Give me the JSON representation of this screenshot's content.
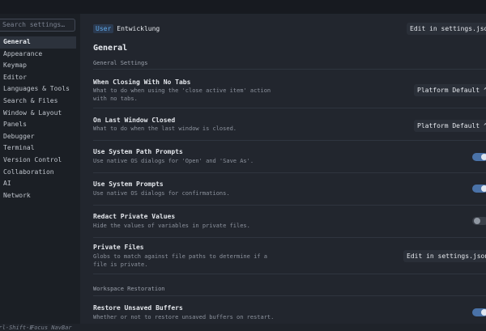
{
  "sidebar": {
    "search_placeholder": "Search settings…",
    "items": [
      "General",
      "Appearance",
      "Keymap",
      "Editor",
      "Languages & Tools",
      "Search & Files",
      "Window & Layout",
      "Panels",
      "Debugger",
      "Terminal",
      "Version Control",
      "Collaboration",
      "AI",
      "Network"
    ],
    "active_index": 0,
    "hint_key": "Ctrl-Shift-E",
    "hint_label": "Focus NavBar"
  },
  "header": {
    "scope_badge": "User",
    "project": "Entwicklung",
    "edit_button": "Edit in settings.json"
  },
  "main": {
    "page_title": "General",
    "section_general": "General Settings",
    "settings": {
      "closing": {
        "title": "When Closing With No Tabs",
        "desc": "What to do when using the 'close active item' action with no tabs.",
        "value": "Platform Default ⌃"
      },
      "last_window": {
        "title": "On Last Window Closed",
        "desc": "What to do when the last window is closed.",
        "value": "Platform Default ⌃"
      },
      "path_prompts": {
        "title": "Use System Path Prompts",
        "desc": "Use native OS dialogs for 'Open' and 'Save As'.",
        "enabled": true
      },
      "system_prompts": {
        "title": "Use System Prompts",
        "desc": "Use native OS dialogs for confirmations.",
        "enabled": true
      },
      "redact": {
        "title": "Redact Private Values",
        "desc": "Hide the values of variables in private files.",
        "enabled": false
      },
      "private_files": {
        "title": "Private Files",
        "desc": "Globs to match against file paths to determine if a file is private.",
        "button": "Edit in settings.json"
      }
    },
    "section_workspace": "Workspace Restoration",
    "restore": {
      "title": "Restore Unsaved Buffers",
      "desc": "Whether or not to restore unsaved buffers on restart.",
      "enabled": true
    }
  }
}
